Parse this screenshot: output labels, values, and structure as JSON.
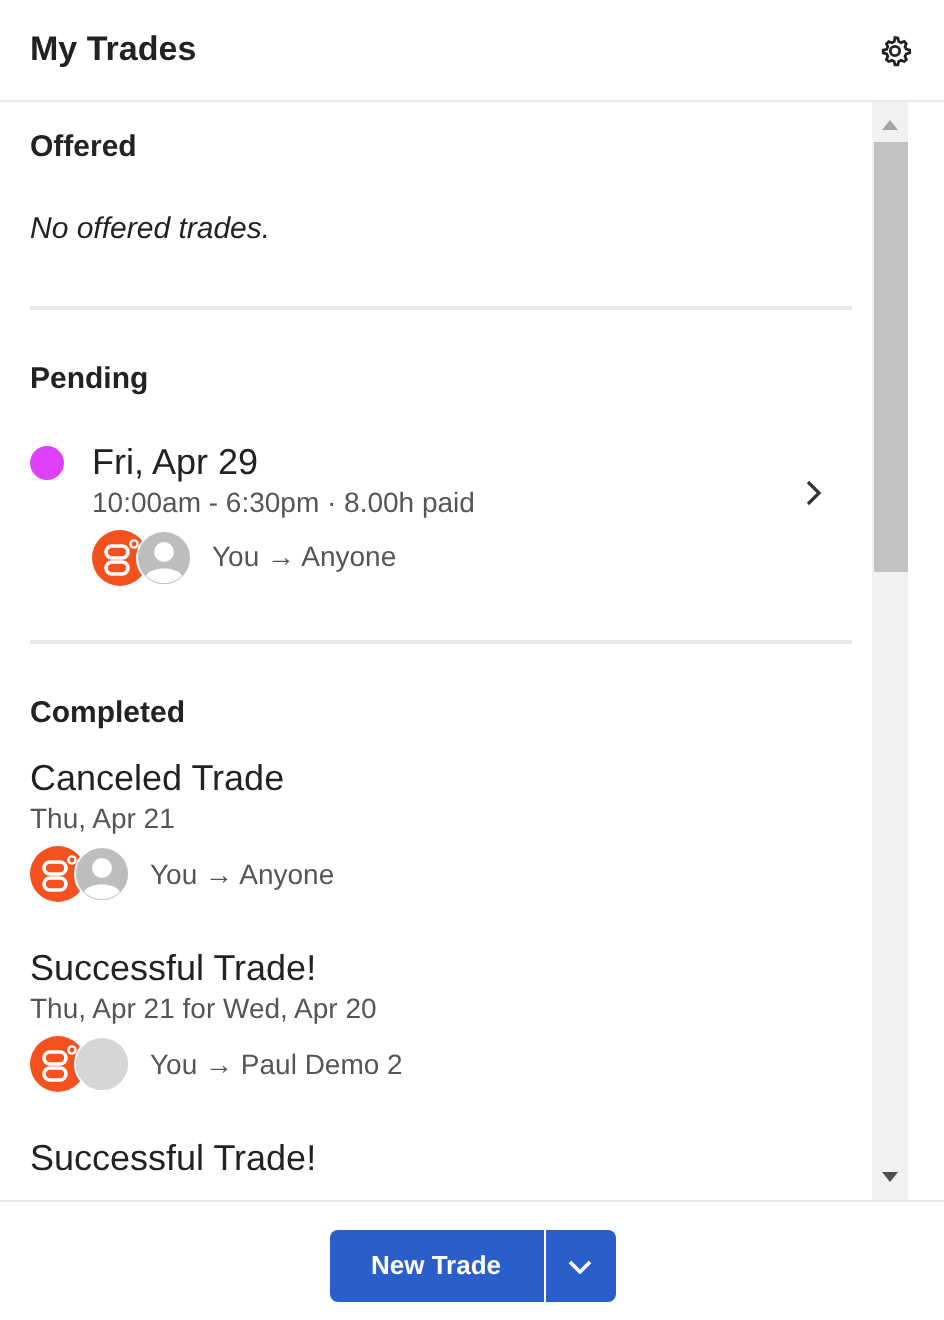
{
  "header": {
    "title": "My Trades"
  },
  "offered": {
    "heading": "Offered",
    "empty_text": "No offered trades."
  },
  "pending": {
    "heading": "Pending",
    "items": [
      {
        "date": "Fri, Apr 29",
        "details": "10:00am - 6:30pm · 8.00h paid",
        "color": "#e040fb",
        "avatars": [
          {
            "kind": "logo"
          },
          {
            "kind": "generic"
          }
        ],
        "route": "You → Anyone"
      }
    ]
  },
  "completed": {
    "heading": "Completed",
    "items": [
      {
        "title": "Canceled Trade",
        "date": "Thu, Apr 21",
        "avatars": [
          {
            "kind": "logo"
          },
          {
            "kind": "generic"
          }
        ],
        "route": "You → Anyone"
      },
      {
        "title": "Successful Trade!",
        "date": "Thu, Apr 21 for Wed, Apr 20",
        "avatars": [
          {
            "kind": "logo"
          },
          {
            "kind": "photo"
          }
        ],
        "route": "You → Paul Demo 2"
      },
      {
        "title": "Successful Trade!"
      }
    ]
  },
  "footer": {
    "button": "New Trade"
  }
}
